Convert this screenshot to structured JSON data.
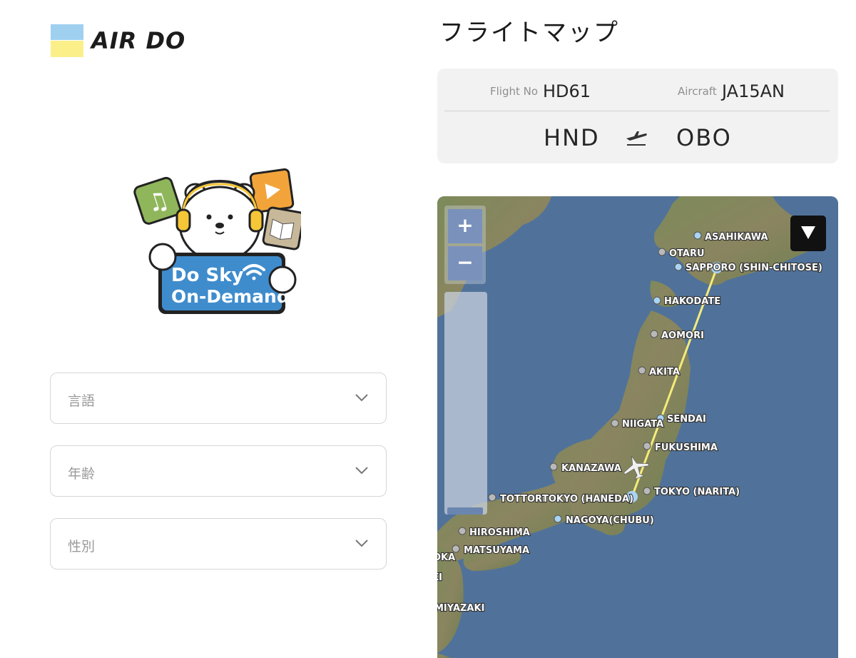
{
  "brand": {
    "logo_text": "AIR DO"
  },
  "mascot": {
    "line1": "Do Sky",
    "line2": "On-Demand"
  },
  "form": {
    "language_placeholder": "言語",
    "age_placeholder": "年齢",
    "gender_placeholder": "性別"
  },
  "flight_map": {
    "title": "フライトマップ",
    "flight_no_label": "Flight No",
    "flight_no": "HD61",
    "aircraft_label": "Aircraft",
    "aircraft": "JA15AN",
    "origin": "HND",
    "destination": "OBO"
  },
  "map": {
    "zoom_in": "+",
    "zoom_out": "−",
    "cities": {
      "asahikawa": "ASAHIKAWA",
      "otaru": "OTARU",
      "sapporo": "SAPPORO (SHIN-CHITOSE)",
      "hakodate": "HAKODATE",
      "aomori": "AOMORI",
      "akita": "AKITA",
      "sendai": "SENDAI",
      "niigata": "NIIGATA",
      "fukushima": "FUKUSHIMA",
      "kanazawa": "KANAZAWA",
      "tottori": "TOTTORI",
      "tokyo_haneda": "TOKYO (HANEDA)",
      "tokyo_narita": "TOKYO (NARITA)",
      "nagoya": "NAGOYA(CHUBU)",
      "hiroshima": "HIROSHIMA",
      "matsuyama": "MATSUYAMA",
      "oka": "OKA",
      "ki": "KI",
      "miyazaki": "MIYAZAKI"
    }
  },
  "colors": {
    "logo_blue": "#9fd0ef",
    "logo_yellow": "#fbef8a",
    "sea": "#50729a",
    "route": "#f4ec7a",
    "city_dot_blue": "#a8d4f5",
    "city_dot_gray": "#b9b9b9"
  }
}
